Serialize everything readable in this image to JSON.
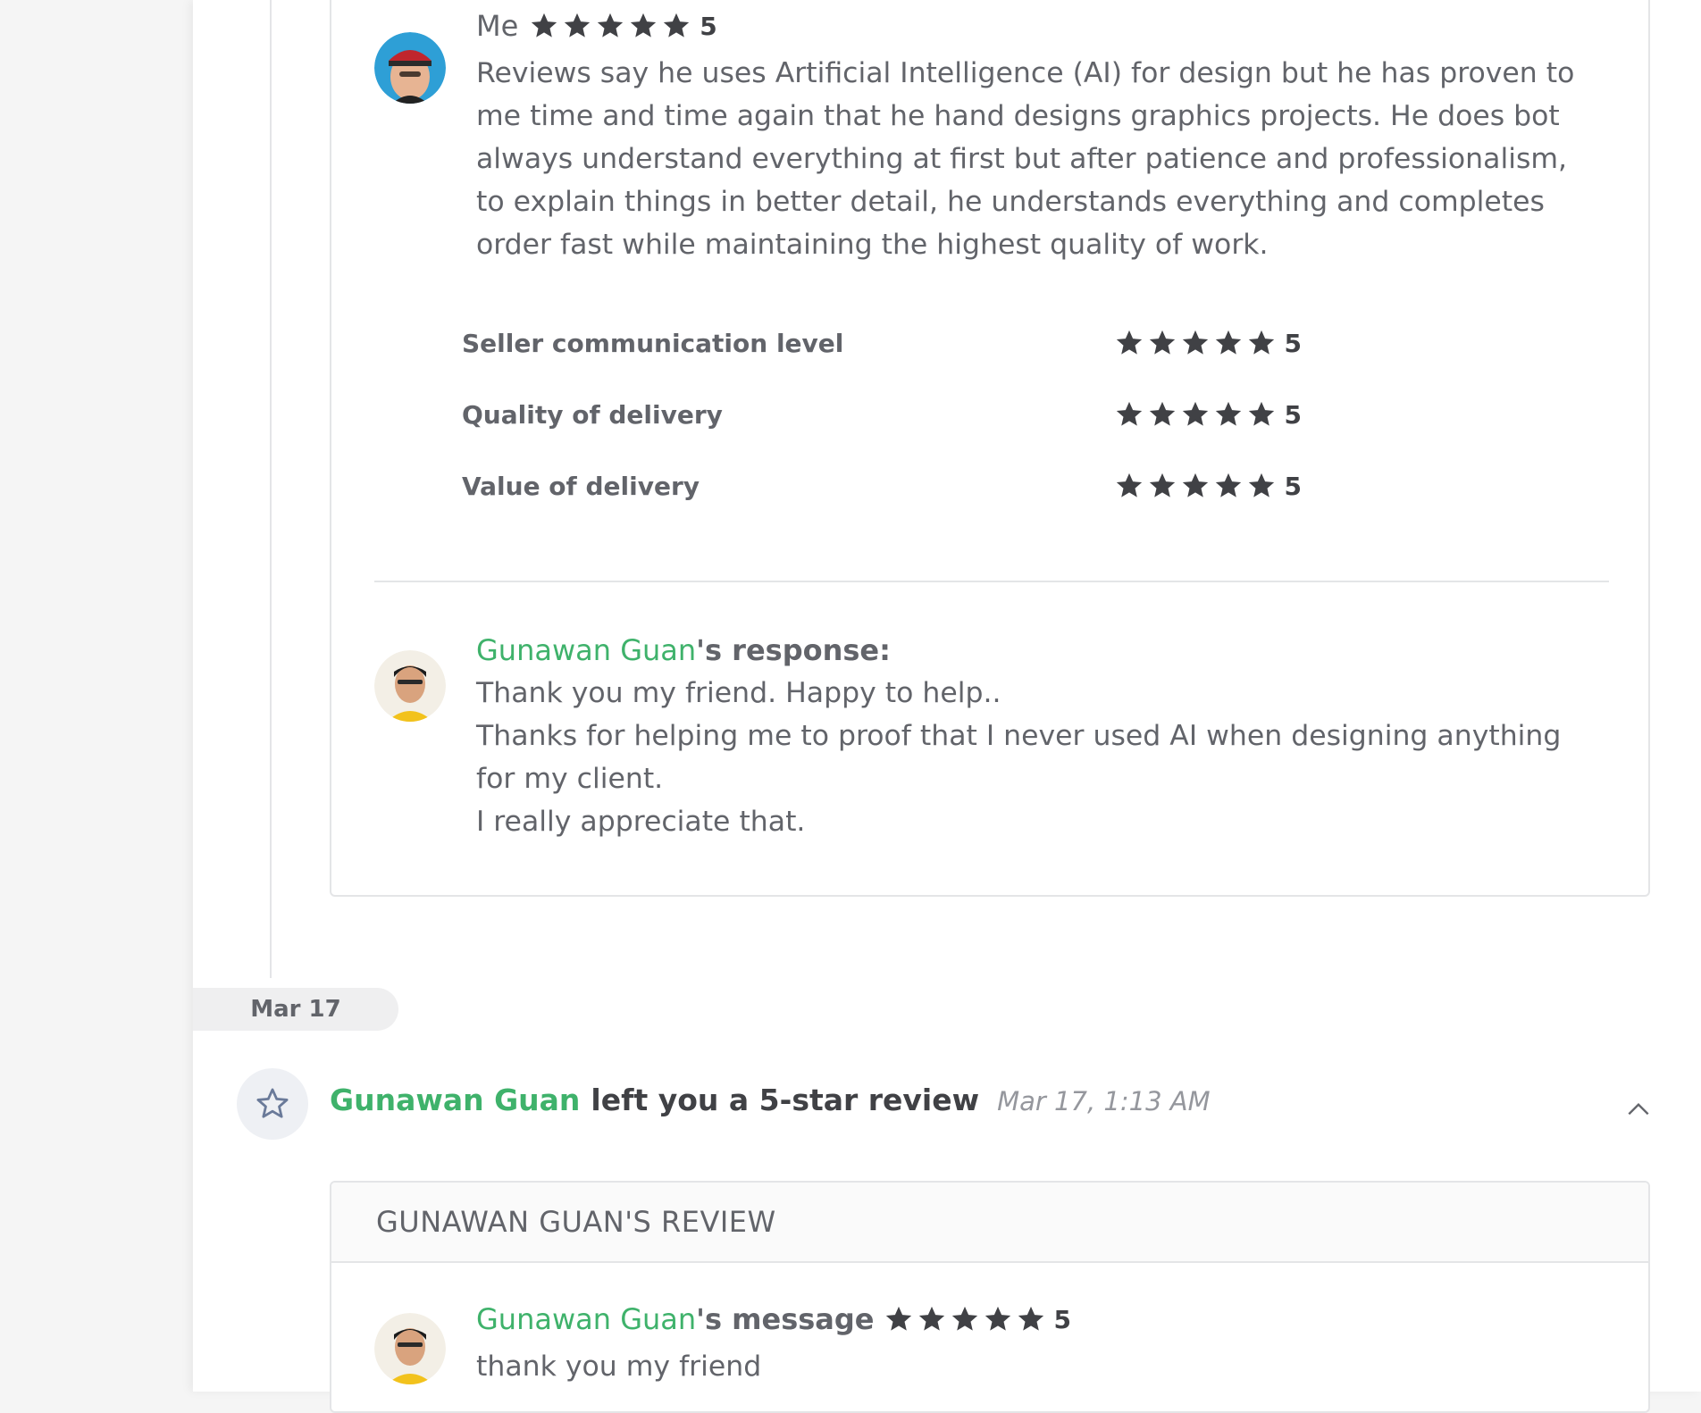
{
  "review": {
    "reviewer_name": "Me",
    "rating": "5",
    "text": "Reviews say he uses Artificial Intelligence (AI) for design but he has proven to me time and time again that he hand designs graphics projects. He does bot always understand everything at first but after patience and professionalism, to explain things in better detail, he understands everything and completes order fast while maintaining the highest quality of work.",
    "ratings": [
      {
        "label": "Seller communication level",
        "value": "5"
      },
      {
        "label": "Quality of delivery",
        "value": "5"
      },
      {
        "label": "Value of delivery",
        "value": "5"
      }
    ]
  },
  "response": {
    "seller_name": "Gunawan Guan",
    "suffix": "'s response:",
    "lines": [
      "Thank you my friend. Happy to help..",
      "Thanks for helping me to proof that I never used AI when designing anything for my client.",
      "I really appreciate that."
    ]
  },
  "date_separator": "Mar 17",
  "event": {
    "actor": "Gunawan Guan",
    "action": "left you a 5-star review",
    "timestamp": "Mar 17, 1:13 AM",
    "icon": "star-outline-icon",
    "toggle_icon": "chevron-up-icon"
  },
  "seller_review": {
    "header": "GUNAWAN GUAN'S REVIEW",
    "name": "Gunawan Guan",
    "suffix": "'s message",
    "rating": "5",
    "text": "thank you my friend"
  },
  "colors": {
    "accent_green": "#3fb26b",
    "star": "#404145",
    "text": "#62646a"
  }
}
